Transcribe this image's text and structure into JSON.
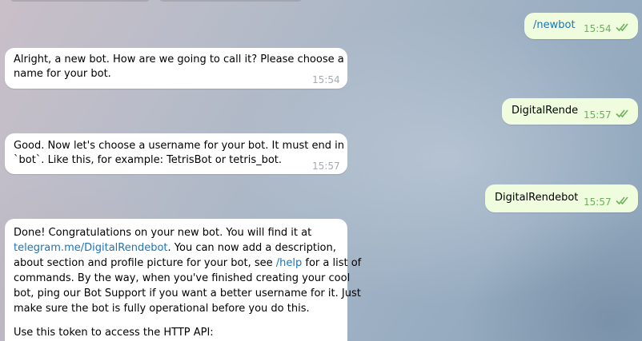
{
  "chat": {
    "messages": [
      {
        "id": "m1",
        "direction": "outgoing",
        "text": "/newbot",
        "time": "15:54",
        "status": "read"
      },
      {
        "id": "m2",
        "direction": "incoming",
        "lines": [
          "Alright, a new bot. How are we going to call it? Please choose a",
          "name for your bot."
        ],
        "time": "15:54"
      },
      {
        "id": "m3",
        "direction": "outgoing",
        "text": "DigitalRende",
        "time": "15:57",
        "status": "read"
      },
      {
        "id": "m4",
        "direction": "incoming",
        "lines": [
          "Good. Now let's choose a username for your bot. It must end in",
          "`bot`. Like this, for example: TetrisBot or tetris_bot."
        ],
        "time": "15:57"
      },
      {
        "id": "m5",
        "direction": "outgoing",
        "text": "DigitalRendebot",
        "time": "15:57",
        "status": "read"
      },
      {
        "id": "m6",
        "direction": "incoming",
        "line1": "Done! Congratulations on your new bot. You will find it at",
        "link": "telegram.me/DigitalRendebot",
        "line2_after_link": ". You can now add a description,",
        "line3": "about section and profile picture for your bot, see ",
        "help_link": "/help",
        "line3_after": " for a list of",
        "line4": "commands. By the way, when you've finished creating your cool",
        "line5": "bot, ping our Bot Support if you want a better username for it. Just",
        "line6": "make sure the bot is fully operational before you do this.",
        "line7": "Use this token to access the HTTP API:"
      }
    ]
  },
  "colors": {
    "outgoing_bubble": "#effdde",
    "incoming_bubble": "#ffffff",
    "link": "#1d73b8",
    "read_check": "#6cb05d"
  },
  "icons": {
    "read_status": "double-check-icon"
  }
}
